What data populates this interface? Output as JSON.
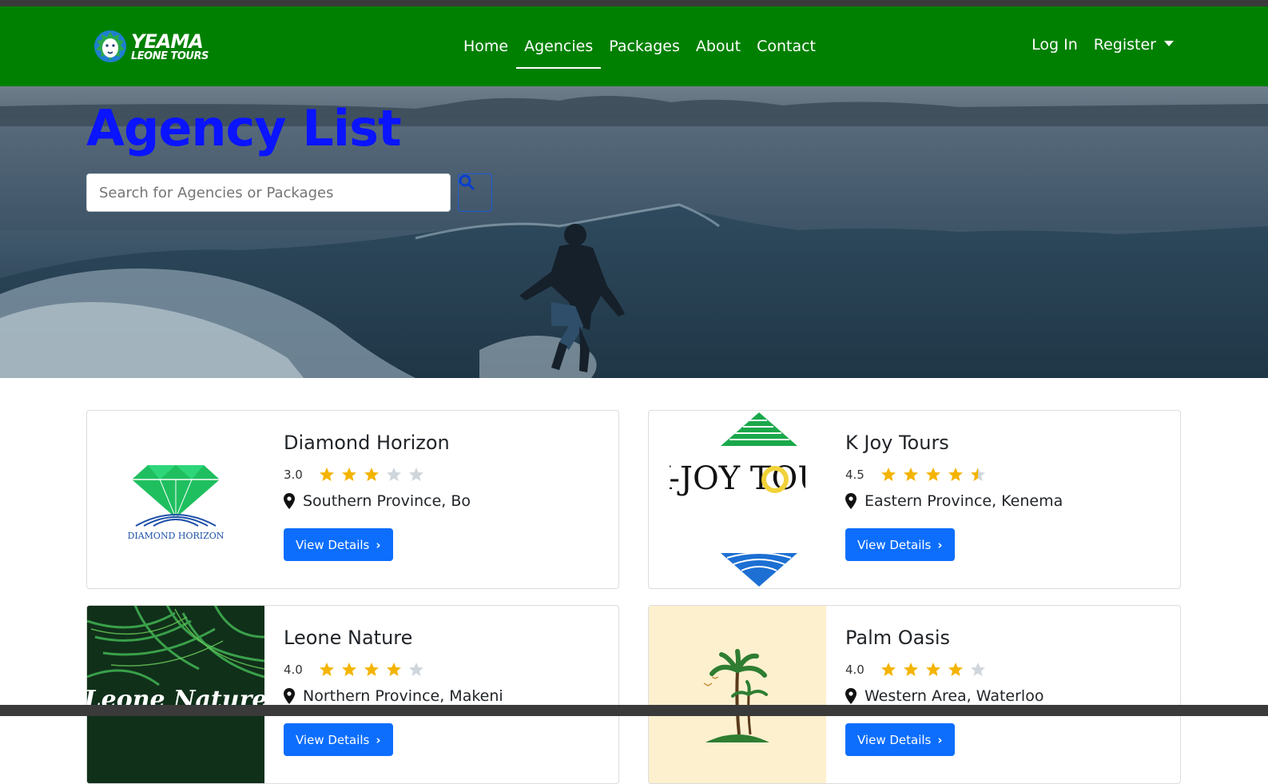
{
  "brand": {
    "line1": "YEAMA",
    "line2": "LEONE TOURS"
  },
  "nav": {
    "links": [
      "Home",
      "Agencies",
      "Packages",
      "About",
      "Contact"
    ],
    "active": "Agencies",
    "login": "Log In",
    "register": "Register"
  },
  "hero": {
    "title": "Agency List",
    "search_placeholder": "Search for Agencies or Packages"
  },
  "agencies": [
    {
      "name": "Diamond Horizon",
      "rating": "3.0",
      "stars": 3,
      "location": "Southern Province, Bo",
      "button": "View Details",
      "logo_text": "DIAMOND HORIZON"
    },
    {
      "name": "K Joy Tours",
      "rating": "4.5",
      "stars": 4.5,
      "location": "Eastern Province, Kenema",
      "button": "View Details",
      "logo_text": "K-JOY TOURS"
    },
    {
      "name": "Leone Nature",
      "rating": "4.0",
      "stars": 4,
      "location": "Northern Province, Makeni",
      "button": "View Details",
      "logo_text": "Leone Nature"
    },
    {
      "name": "Palm Oasis",
      "rating": "4.0",
      "stars": 4,
      "location": "Western Area, Waterloo",
      "button": "View Details"
    }
  ],
  "colors": {
    "nav_bg": "#008000",
    "title": "#0a14ff",
    "button": "#0d6efd",
    "star": "#f4b400",
    "star_empty": "#cfd6dc"
  }
}
